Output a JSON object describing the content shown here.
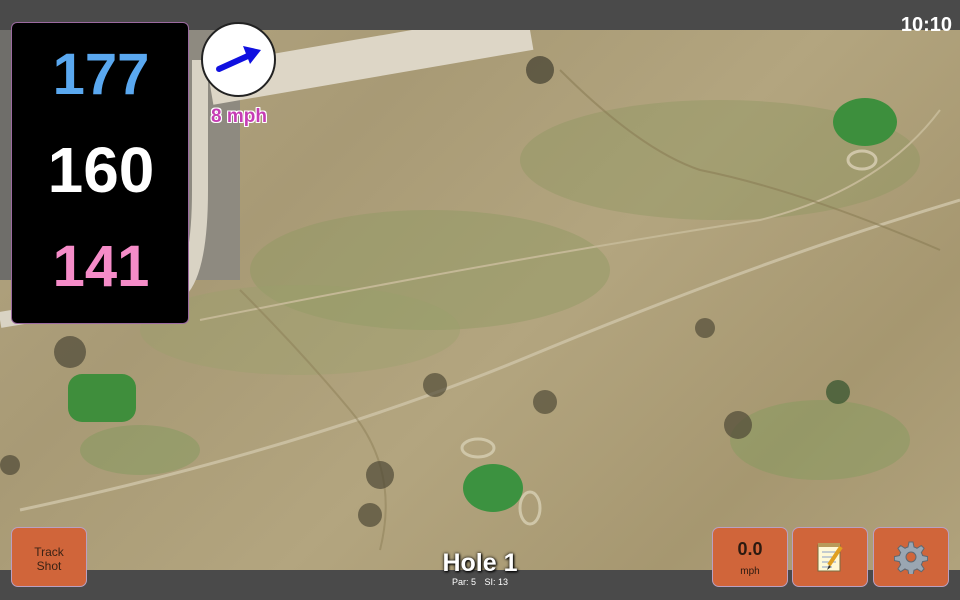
{
  "status": {
    "time": "10:10"
  },
  "distances": {
    "back": "177",
    "middle": "160",
    "front": "141",
    "colors": {
      "back": "#5aa8f0",
      "middle": "#ffffff",
      "front": "#f58cc8"
    }
  },
  "wind": {
    "speed_label": "8 mph",
    "icon": "wind-arrow-icon",
    "arrow_color": "#1010e0"
  },
  "buttons": {
    "track_shot_line1": "Track",
    "track_shot_line2": "Shot",
    "speed_value": "0.0",
    "speed_unit": "mph",
    "notes_icon": "notepad-icon",
    "settings_icon": "gear-icon"
  },
  "hole": {
    "title": "Hole 1",
    "par": "Par: 5",
    "si": "SI: 13"
  },
  "colors": {
    "button": "#d0653a",
    "bar": "#4a4a4a",
    "panel": "#000000",
    "wind_text": "#c63cb4"
  }
}
